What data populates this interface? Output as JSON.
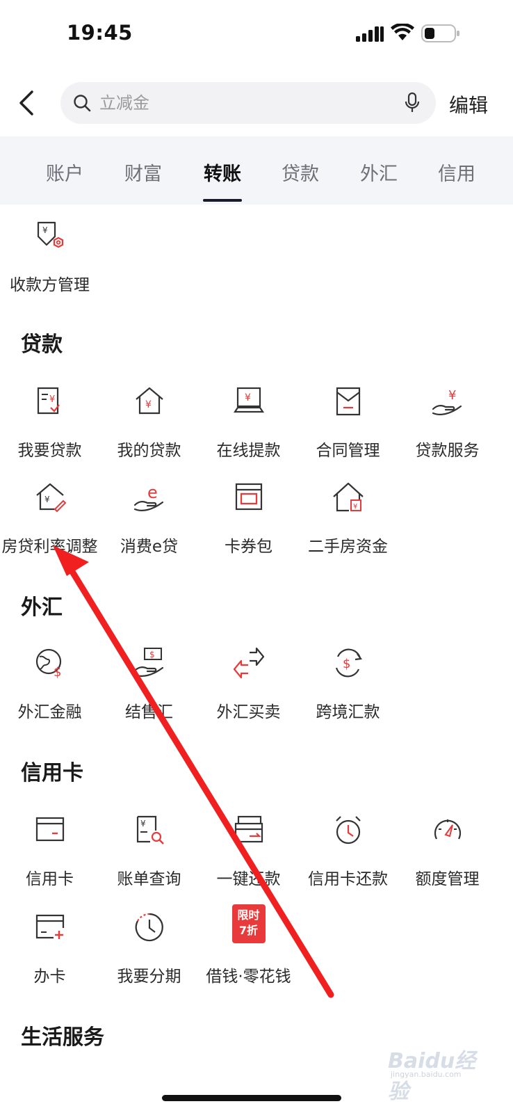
{
  "status_bar": {
    "time": "19:45"
  },
  "header": {
    "search": {
      "placeholder": "立减金",
      "value": ""
    },
    "edit_label": "编辑"
  },
  "tabs": [
    {
      "label": "账户",
      "active": false
    },
    {
      "label": "财富",
      "active": false
    },
    {
      "label": "转账",
      "active": true
    },
    {
      "label": "贷款",
      "active": false
    },
    {
      "label": "外汇",
      "active": false
    },
    {
      "label": "信用",
      "active": false
    }
  ],
  "transfer_section": {
    "items": [
      {
        "label": "收款方管理",
        "icon": "payee-manage-icon"
      }
    ]
  },
  "loan_section": {
    "title": "贷款",
    "items": [
      {
        "label": "我要贷款",
        "icon": "apply-loan-icon"
      },
      {
        "label": "我的贷款",
        "icon": "my-loan-icon"
      },
      {
        "label": "在线提款",
        "icon": "online-withdraw-icon"
      },
      {
        "label": "合同管理",
        "icon": "contract-icon"
      },
      {
        "label": "贷款服务",
        "icon": "loan-service-icon"
      },
      {
        "label": "房贷利率调整",
        "icon": "mortgage-rate-icon"
      },
      {
        "label": "消费e贷",
        "icon": "consumer-loan-icon"
      },
      {
        "label": "卡券包",
        "icon": "coupon-wallet-icon"
      },
      {
        "label": "二手房资金",
        "icon": "second-hand-house-icon"
      }
    ]
  },
  "forex_section": {
    "title": "外汇",
    "items": [
      {
        "label": "外汇金融",
        "icon": "forex-finance-icon"
      },
      {
        "label": "结售汇",
        "icon": "exchange-settlement-icon"
      },
      {
        "label": "外汇买卖",
        "icon": "forex-trade-icon"
      },
      {
        "label": "跨境汇款",
        "icon": "cross-border-remit-icon"
      }
    ]
  },
  "credit_section": {
    "title": "信用卡",
    "items": [
      {
        "label": "信用卡",
        "icon": "credit-card-icon"
      },
      {
        "label": "账单查询",
        "icon": "bill-query-icon"
      },
      {
        "label": "一键还款",
        "icon": "one-click-repay-icon"
      },
      {
        "label": "信用卡还款",
        "icon": "card-repay-clock-icon"
      },
      {
        "label": "额度管理",
        "icon": "limit-gauge-icon"
      },
      {
        "label": "办卡",
        "icon": "apply-card-icon"
      },
      {
        "label": "我要分期",
        "icon": "installment-icon"
      },
      {
        "label": "借钱·零花钱",
        "icon": "promo-badge",
        "badge_line1": "限时",
        "badge_line2": "7折"
      }
    ]
  },
  "life_section": {
    "title": "生活服务"
  },
  "watermark": {
    "brand": "Baidu经验",
    "url": "jingyan.baidu.com"
  },
  "colors": {
    "accent_red": "#e83a3a",
    "icon_dark": "#333333",
    "tab_bg": "#f4f5f8"
  }
}
